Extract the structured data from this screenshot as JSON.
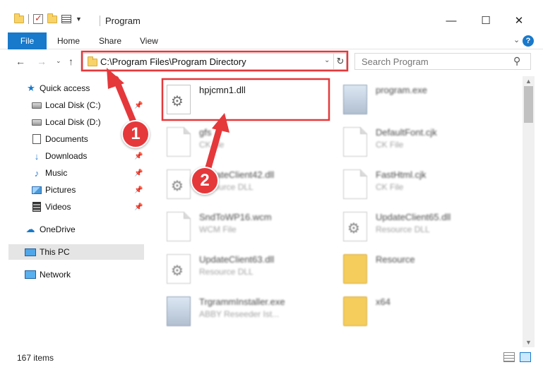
{
  "window": {
    "title": "Program",
    "minimize_glyph": "—",
    "maximize_glyph": "☐",
    "close_glyph": "✕"
  },
  "ribbon": {
    "tabs": [
      {
        "label": "File"
      },
      {
        "label": "Home"
      },
      {
        "label": "Share"
      },
      {
        "label": "View"
      }
    ],
    "help_glyph": "?"
  },
  "nav": {
    "address": "C:\\Program Files\\Program Directory",
    "search_placeholder": "Search Program"
  },
  "sidebar": {
    "items": [
      {
        "label": "Quick access",
        "icon": "star-icon"
      },
      {
        "label": "Local Disk (C:)",
        "icon": "drive-icon"
      },
      {
        "label": "Local Disk (D:)",
        "icon": "drive-icon"
      },
      {
        "label": "Documents",
        "icon": "documents-icon"
      },
      {
        "label": "Downloads",
        "icon": "download-icon"
      },
      {
        "label": "Music",
        "icon": "music-icon"
      },
      {
        "label": "Pictures",
        "icon": "pictures-icon"
      },
      {
        "label": "Videos",
        "icon": "videos-icon"
      },
      {
        "label": "OneDrive",
        "icon": "cloud-icon"
      },
      {
        "label": "This PC",
        "icon": "computer-icon"
      },
      {
        "label": "Network",
        "icon": "network-icon"
      }
    ]
  },
  "files": [
    {
      "name": "hpjcmn1.dll",
      "type": "",
      "icon": "dll-gear-icon"
    },
    {
      "name": "program.exe",
      "type": "",
      "icon": "exe-icon"
    },
    {
      "name": "gfs",
      "type": "CK file",
      "icon": "blank-file-icon"
    },
    {
      "name": "DefaultFont.cjk",
      "type": "CK File",
      "icon": "blank-file-icon"
    },
    {
      "name": "UpdateClient42.dll",
      "type": "Resource DLL",
      "icon": "dll-gear-icon"
    },
    {
      "name": "FastHtml.cjk",
      "type": "CK File",
      "icon": "blank-file-icon"
    },
    {
      "name": "SndToWP16.wcm",
      "type": "WCM File",
      "icon": "blank-file-icon"
    },
    {
      "name": "UpdateClient65.dll",
      "type": "Resource DLL",
      "icon": "dll-gear-icon"
    },
    {
      "name": "UpdateClient63.dll",
      "type": "Resource DLL",
      "icon": "dll-gear-icon"
    },
    {
      "name": "Resource",
      "type": "",
      "icon": "folder-icon"
    },
    {
      "name": "TrgrammInstaller.exe",
      "type": "ABBY Reseeder Ist...",
      "icon": "installer-icon"
    },
    {
      "name": "x64",
      "type": "",
      "icon": "folder-icon"
    }
  ],
  "annotations": {
    "badge_1": "1",
    "badge_2": "2",
    "accent_color": "#e5383b"
  },
  "status": {
    "item_count": "167 items"
  }
}
